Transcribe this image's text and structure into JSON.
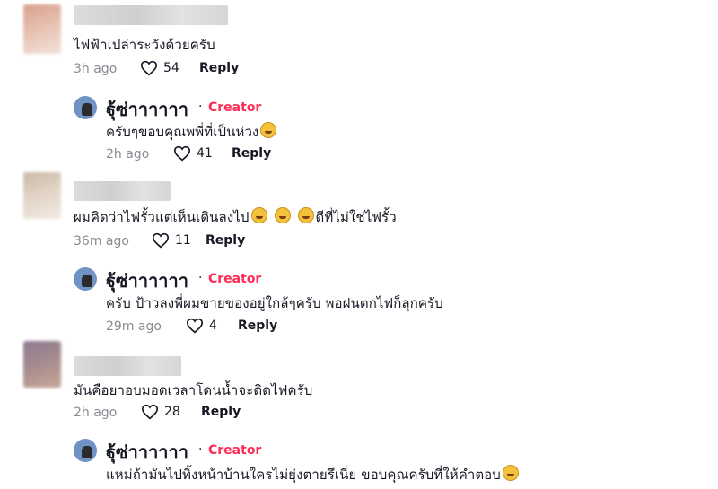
{
  "creator": {
    "name": "ฐุ้ซ่าาาาาา",
    "separator": "·",
    "badge": "Creator"
  },
  "accent_color": "#fe2c55",
  "comments": [
    {
      "text": "ไฟฟ้าเปล่าระวังด้วยครับ",
      "time": "3h ago",
      "likes": "54",
      "reply_label": "Reply",
      "reply": {
        "text": "ครับๆขอบคุณพพี่ที่เป็นห่วง",
        "time": "2h ago",
        "likes": "41",
        "reply_label": "Reply"
      }
    },
    {
      "text_before": "ผมคิดว่าไฟรั้วแต่เห็นเดินลงไป",
      "text_after": "ดีที่ไม่ใช่ไฟรั้ว",
      "time": "36m ago",
      "likes": "11",
      "reply_label": "Reply",
      "reply": {
        "text": "ครับ ป้าวลงพี่ผมขายของอยู่ใกล้ๆครับ พอฝนตกไฟก็ลุกครับ",
        "time": "29m ago",
        "likes": "4",
        "reply_label": "Reply"
      }
    },
    {
      "text": "มันคือยาอบมอดเวลาโดนน้ำจะติดไฟครับ",
      "time": "2h ago",
      "likes": "28",
      "reply_label": "Reply",
      "reply": {
        "text": "แหม่ถ้ามันไปทิ้งหน้าบ้านใครไม่ยุ่งตายรึเนี่ย ขอบคุณครับที่ให้คำตอบ"
      }
    }
  ]
}
